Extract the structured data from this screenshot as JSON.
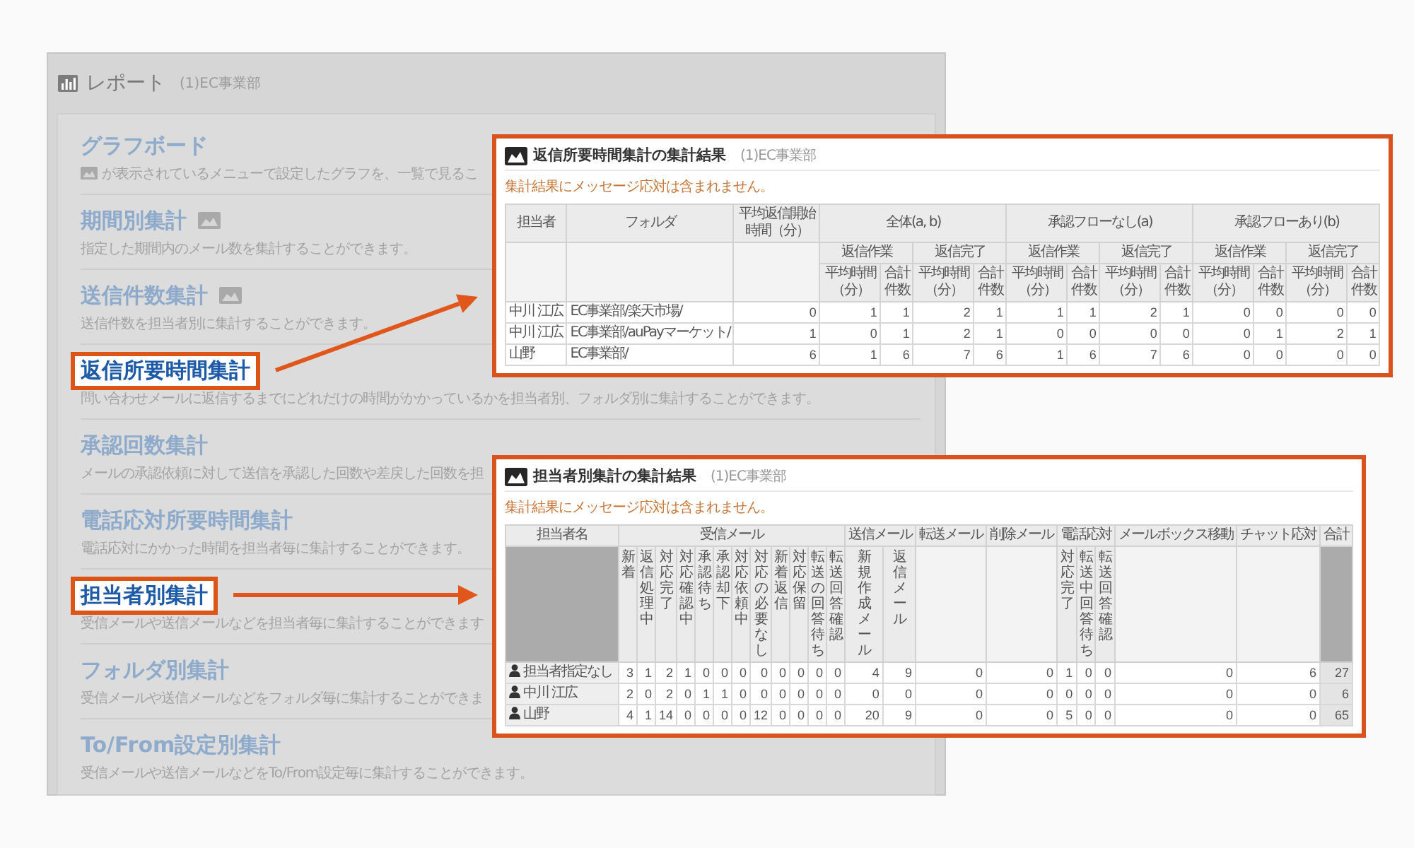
{
  "report_panel": {
    "title": "レポート",
    "department": "(1)EC事業部",
    "items": [
      {
        "title": "グラフボード",
        "title_icon": false,
        "description_icon": true,
        "description": "が表示されているメニューで設定したグラフを、一覧で見るこ",
        "highlighted": false
      },
      {
        "title": "期間別集計",
        "title_icon": true,
        "description_icon": false,
        "description": "指定した期間内のメール数を集計することができます。",
        "highlighted": false
      },
      {
        "title": "送信件数集計",
        "title_icon": true,
        "description_icon": false,
        "description": "送信件数を担当者別に集計することができます。",
        "highlighted": false
      },
      {
        "title": "返信所要時間集計",
        "title_icon": false,
        "description_icon": false,
        "description": "問い合わせメールに返信するまでにどれだけの時間がかかっているかを担当者別、フォルダ別に集計することができます。",
        "highlighted": true
      },
      {
        "title": "承認回数集計",
        "title_icon": false,
        "description_icon": false,
        "description": "メールの承認依頼に対して送信を承認した回数や差戻した回数を担",
        "highlighted": false
      },
      {
        "title": "電話応対所要時間集計",
        "title_icon": false,
        "description_icon": false,
        "description": "電話応対にかかった時間を担当者毎に集計することができます。",
        "highlighted": false
      },
      {
        "title": "担当者別集計",
        "title_icon": false,
        "description_icon": false,
        "description": "受信メールや送信メールなどを担当者毎に集計することができます",
        "highlighted": true
      },
      {
        "title": "フォルダ別集計",
        "title_icon": false,
        "description_icon": false,
        "description": "受信メールや送信メールなどをフォルダ毎に集計することができま",
        "highlighted": false
      },
      {
        "title": "To/From設定別集計",
        "title_icon": false,
        "description_icon": false,
        "description": "受信メールや送信メールなどをTo/From設定毎に集計することができます。",
        "highlighted": false
      }
    ]
  },
  "result_panels": [
    {
      "kind": "response_time",
      "title": "返信所要時間集計の集計結果",
      "department": "(1)EC事業部",
      "note": "集計結果にメッセージ応対は含まれません。",
      "columns": [
        {
          "label": "担当者"
        },
        {
          "label": "フォルダ"
        },
        {
          "label": "平均返信開始時間（分）"
        },
        {
          "label": "全体(a, b)",
          "children": [
            {
              "label": "返信作業",
              "children": [
                {
                  "label": "平均時間（分）"
                },
                {
                  "label": "合計件数"
                }
              ]
            },
            {
              "label": "返信完了",
              "children": [
                {
                  "label": "平均時間（分）"
                },
                {
                  "label": "合計件数"
                }
              ]
            }
          ]
        },
        {
          "label": "承認フローなし(a)",
          "children": [
            {
              "label": "返信作業",
              "children": [
                {
                  "label": "平均時間（分）"
                },
                {
                  "label": "合計件数"
                }
              ]
            },
            {
              "label": "返信完了",
              "children": [
                {
                  "label": "平均時間（分）"
                },
                {
                  "label": "合計件数"
                }
              ]
            }
          ]
        },
        {
          "label": "承認フローあり(b)",
          "children": [
            {
              "label": "返信作業",
              "children": [
                {
                  "label": "平均時間（分）"
                },
                {
                  "label": "合計件数"
                }
              ]
            },
            {
              "label": "返信完了",
              "children": [
                {
                  "label": "平均時間（分）"
                },
                {
                  "label": "合計件数"
                }
              ]
            }
          ]
        }
      ],
      "rows": [
        {
          "name": "中川 江広",
          "folder": "EC事業部/楽天市場/",
          "values": [
            "0",
            "1",
            "1",
            "2",
            "1",
            "1",
            "1",
            "2",
            "1",
            "0",
            "0",
            "0",
            "0"
          ]
        },
        {
          "name": "中川 江広",
          "folder": "EC事業部/auPayマーケット/",
          "values": [
            "1",
            "0",
            "1",
            "2",
            "1",
            "0",
            "0",
            "0",
            "0",
            "0",
            "1",
            "2",
            "1"
          ]
        },
        {
          "name": "山野",
          "folder": "EC事業部/",
          "values": [
            "6",
            "1",
            "6",
            "7",
            "6",
            "1",
            "6",
            "7",
            "6",
            "0",
            "0",
            "0",
            "0"
          ]
        }
      ]
    },
    {
      "kind": "by_person",
      "title": "担当者別集計の集計結果",
      "department": "(1)EC事業部",
      "note": "集計結果にメッセージ応対は含まれません。",
      "columns": [
        {
          "label": "担当者名"
        },
        {
          "label": "受信メール",
          "children": [
            {
              "label": "新着"
            },
            {
              "label": "返信処理中"
            },
            {
              "label": "対応完了"
            },
            {
              "label": "対応確認中"
            },
            {
              "label": "承認待ち"
            },
            {
              "label": "承認却下"
            },
            {
              "label": "対応依頼中"
            },
            {
              "label": "対応の必要なし"
            },
            {
              "label": "新着返信"
            },
            {
              "label": "対応保留"
            },
            {
              "label": "転送の回答待ち"
            },
            {
              "label": "転送回答確認"
            }
          ]
        },
        {
          "label": "送信メール",
          "children": [
            {
              "label": "新規作成メール"
            },
            {
              "label": "返信メール"
            }
          ]
        },
        {
          "label": "転送メール"
        },
        {
          "label": "削除メール"
        },
        {
          "label": "電話応対",
          "children": [
            {
              "label": "対応完了"
            },
            {
              "label": "転送中回答待ち"
            },
            {
              "label": "転送回答確認"
            }
          ]
        },
        {
          "label": "メールボックス移動"
        },
        {
          "label": "チャット応対"
        },
        {
          "label": "合計"
        }
      ],
      "rows": [
        {
          "name": "担当者指定なし",
          "values": [
            "3",
            "1",
            "2",
            "1",
            "0",
            "0",
            "0",
            "0",
            "0",
            "0",
            "0",
            "0",
            "4",
            "9",
            "0",
            "0",
            "1",
            "0",
            "0",
            "0",
            "6",
            "27"
          ]
        },
        {
          "name": "中川 江広",
          "values": [
            "2",
            "0",
            "2",
            "0",
            "1",
            "1",
            "0",
            "0",
            "0",
            "0",
            "0",
            "0",
            "0",
            "0",
            "0",
            "0",
            "0",
            "0",
            "0",
            "0",
            "0",
            "6"
          ]
        },
        {
          "name": "山野",
          "values": [
            "4",
            "1",
            "14",
            "0",
            "0",
            "0",
            "0",
            "12",
            "0",
            "0",
            "0",
            "0",
            "20",
            "9",
            "0",
            "0",
            "5",
            "0",
            "0",
            "0",
            "0",
            "65"
          ]
        }
      ]
    }
  ]
}
